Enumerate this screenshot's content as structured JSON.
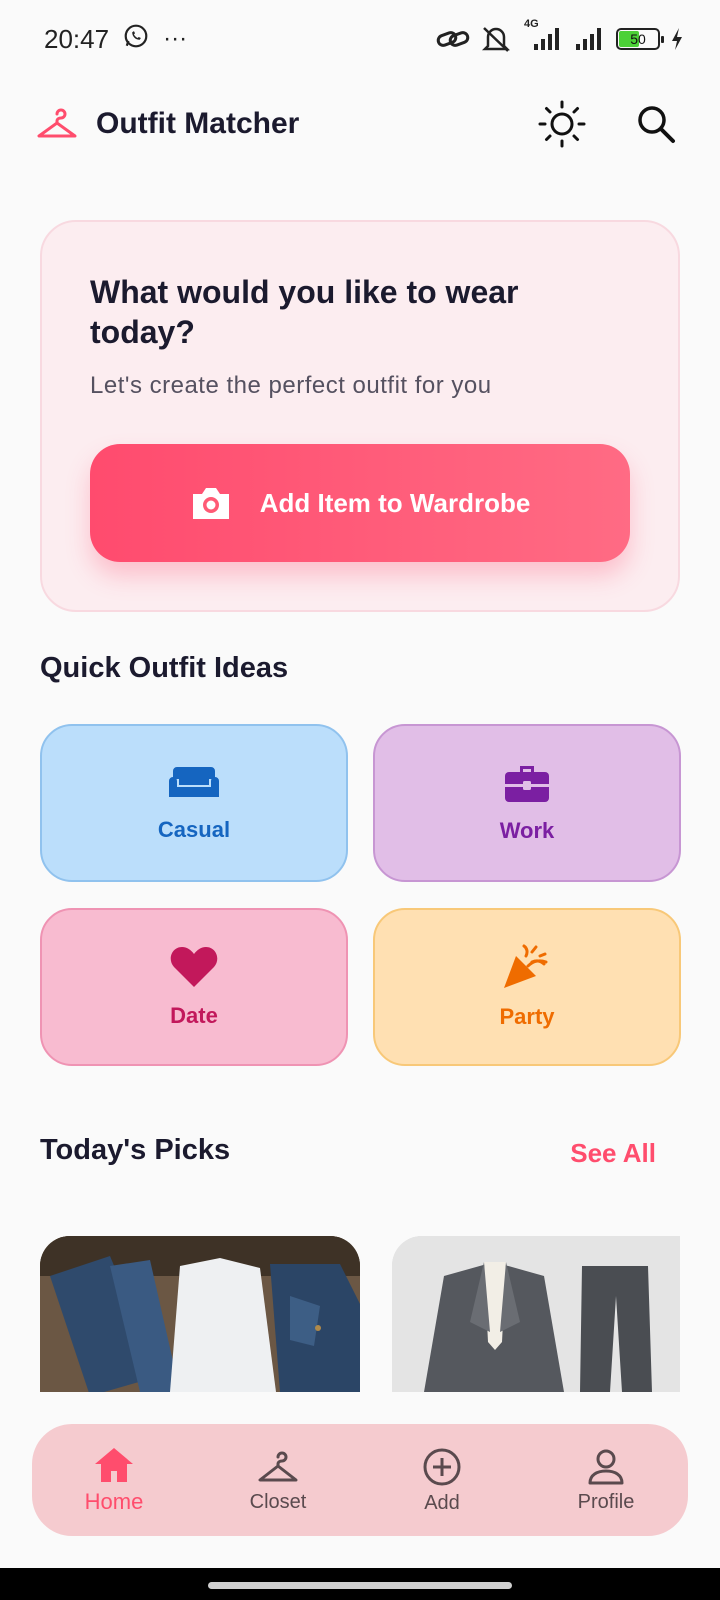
{
  "status_bar": {
    "time": "20:47",
    "more": "···",
    "network": "4G",
    "battery": "50"
  },
  "app_bar": {
    "title": "Outfit Matcher"
  },
  "hero": {
    "heading": "What would you like to wear today?",
    "subtitle": "Let's create the perfect outfit for you",
    "button_label": "Add Item to Wardrobe"
  },
  "quick_ideas": {
    "title": "Quick Outfit Ideas",
    "items": [
      {
        "label": "Casual",
        "icon": "sofa-icon",
        "color": "#1565c0"
      },
      {
        "label": "Work",
        "icon": "briefcase-icon",
        "color": "#7b1fa2"
      },
      {
        "label": "Date",
        "icon": "heart-icon",
        "color": "#c2185b"
      },
      {
        "label": "Party",
        "icon": "party-popper-icon",
        "color": "#ef6c00"
      }
    ]
  },
  "picks": {
    "title": "Today's Picks",
    "see_all": "See All"
  },
  "bottom_nav": {
    "items": [
      {
        "label": "Home",
        "icon": "home-icon",
        "active": true
      },
      {
        "label": "Closet",
        "icon": "hanger-icon",
        "active": false
      },
      {
        "label": "Add",
        "icon": "add-circle-icon",
        "active": false
      },
      {
        "label": "Profile",
        "icon": "person-icon",
        "active": false
      }
    ]
  },
  "colors": {
    "accent": "#ff4d6d",
    "background": "#fafafa",
    "nav_background": "#f5cbcf"
  }
}
